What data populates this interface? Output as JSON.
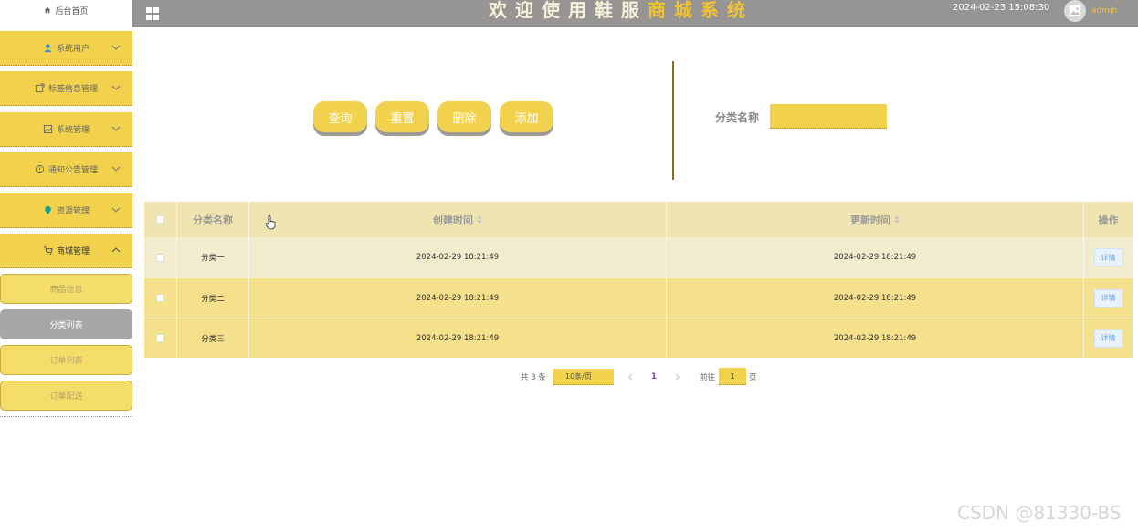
{
  "sidebar": {
    "home_label": "后台首页",
    "menus": [
      {
        "label": "系统用户"
      },
      {
        "label": "标签信息管理"
      },
      {
        "label": "系统管理"
      },
      {
        "label": "通知公告管理"
      },
      {
        "label": "资源管理"
      },
      {
        "label": "商城管理"
      }
    ],
    "submenus": [
      {
        "label": "商品信息"
      },
      {
        "label": "分类列表"
      },
      {
        "label": "订单列表"
      },
      {
        "label": "订单配送"
      }
    ]
  },
  "header": {
    "title_part1": "欢迎使用鞋服",
    "title_part2": "商城系统",
    "datetime": "2024-02-23 15:08:30",
    "username": "admin"
  },
  "toolbar": {
    "query": "查询",
    "reset": "重置",
    "delete": "删除",
    "add": "添加",
    "search_label": "分类名称",
    "search_value": ""
  },
  "table": {
    "columns": [
      "分类名称",
      "创建时间",
      "更新时间",
      "操作"
    ],
    "rows": [
      {
        "name": "分类一",
        "created": "2024-02-29 18:21:49",
        "updated": "2024-02-29 18:21:49",
        "action": "详情"
      },
      {
        "name": "分类二",
        "created": "2024-02-29 18:21:49",
        "updated": "2024-02-29 18:21:49",
        "action": "详情"
      },
      {
        "name": "分类三",
        "created": "2024-02-29 18:21:49",
        "updated": "2024-02-29 18:21:49",
        "action": "详情"
      }
    ]
  },
  "pagination": {
    "total": "共 3 条",
    "page_size": "10条/页",
    "current_page": "1",
    "goto_label": "前往",
    "goto_value": "1",
    "page_suffix": "页"
  },
  "watermark": "CSDN @81330-BS",
  "colors": {
    "accent": "#f2d24c",
    "header": "#979593",
    "selected_submenu": "#a9a7a5"
  }
}
